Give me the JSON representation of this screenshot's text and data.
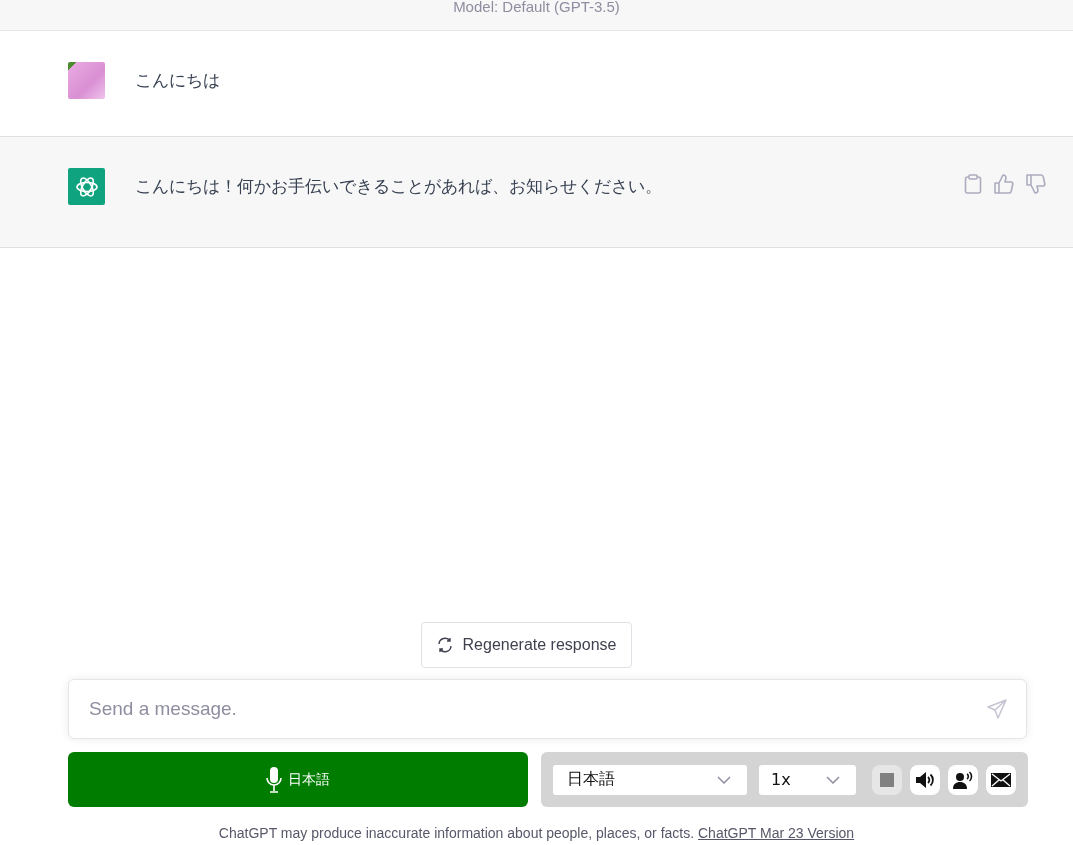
{
  "header": {
    "title": "Model: Default (GPT-3.5)"
  },
  "messages": [
    {
      "kind": "user",
      "text": "こんにちは"
    },
    {
      "kind": "assistant",
      "text": "こんにちは！何かお手伝いできることがあれば、お知らせください。"
    }
  ],
  "regenerate_button": {
    "label": "Regenerate response"
  },
  "composer": {
    "placeholder": "Send a message."
  },
  "voice_button": {
    "label": "日本語"
  },
  "voice_panel": {
    "language_select": {
      "value": "日本語"
    },
    "speed_select": {
      "value": "1x"
    },
    "buttons": [
      {
        "kind": "stop",
        "pressed": true
      },
      {
        "kind": "speaker",
        "pressed": false
      },
      {
        "kind": "voice",
        "pressed": false
      },
      {
        "kind": "mail",
        "pressed": false
      }
    ]
  },
  "footer": {
    "text": "ChatGPT may produce inaccurate information about people, places, or facts.",
    "link": "ChatGPT Mar 23 Version"
  }
}
